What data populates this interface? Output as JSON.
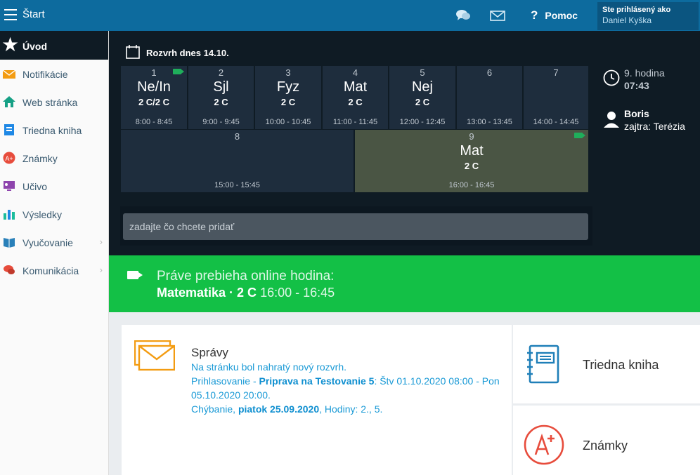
{
  "topbar": {
    "title": "Štart",
    "help_label": "Pomoc",
    "help_icon": "?",
    "user_title": "Ste prihlásený ako",
    "user_name": "Daniel Kyška"
  },
  "sidebar": {
    "active": "Úvod",
    "items": [
      {
        "label": "Notifikácie",
        "icon": "envelope-icon"
      },
      {
        "label": "Web stránka",
        "icon": "home-icon"
      },
      {
        "label": "Triedna kniha",
        "icon": "book-icon"
      },
      {
        "label": "Známky",
        "icon": "grade-icon"
      },
      {
        "label": "Učivo",
        "icon": "monitor-icon"
      },
      {
        "label": "Výsledky",
        "icon": "bar-chart-icon"
      },
      {
        "label": "Vyučovanie",
        "icon": "open-book-icon"
      },
      {
        "label": "Komunikácia",
        "icon": "chat-icon"
      }
    ]
  },
  "schedule": {
    "title": "Rozvrh dnes 14.10.",
    "row1": [
      {
        "num": "1",
        "subject": "Ne/In",
        "class": "2 C/2 C",
        "time": "8:00 - 8:45"
      },
      {
        "num": "2",
        "subject": "Sjl",
        "class": "2 C",
        "time": "9:00 - 9:45"
      },
      {
        "num": "3",
        "subject": "Fyz",
        "class": "2 C",
        "time": "10:00 - 10:45"
      },
      {
        "num": "4",
        "subject": "Mat",
        "class": "2 C",
        "time": "11:00 - 11:45"
      },
      {
        "num": "5",
        "subject": "Nej",
        "class": "2 C",
        "time": "12:00 - 12:45"
      },
      {
        "num": "6",
        "subject": "",
        "class": "",
        "time": "13:00 - 13:45"
      },
      {
        "num": "7",
        "subject": "",
        "class": "",
        "time": "14:00 - 14:45"
      }
    ],
    "row2": [
      {
        "num": "8",
        "subject": "",
        "class": "",
        "time": "15:00 - 15:45"
      },
      {
        "num": "9",
        "subject": "Mat",
        "class": "2 C",
        "time": "16:00 - 16:45"
      }
    ],
    "current_hour": "9. hodina",
    "current_time": "07:43",
    "duty_name": "Boris",
    "duty_tomorrow": "zajtra: Terézia",
    "add_placeholder": "zadajte čo chcete pridať"
  },
  "online": {
    "heading": "Práve prebieha online hodina:",
    "subject": "Matematika · 2 C",
    "time": "16:00 - 16:45"
  },
  "messages": {
    "title": "Správy",
    "line1": "Na stránku bol nahratý nový rozvrh.",
    "line2_prefix": "Prihlasovanie - ",
    "line2_bold": "Priprava na Testovanie 5",
    "line2_suffix": ": Štv 01.10.2020 08:00 - Pon 05.10.2020 20:00.",
    "line3_prefix": "Chýbanie, ",
    "line3_bold": "piatok 25.09.2020",
    "line3_suffix": ", Hodiny: 2., 5."
  },
  "tiles": {
    "triedna_kniha": "Triedna kniha",
    "znamky": "Známky"
  },
  "colors": {
    "topbar": "#0d6b9e",
    "dark_bg": "#0f1b24",
    "cell": "#1e2d3d",
    "cell_current": "#4a5544",
    "online_green": "#13c046",
    "link_blue": "#1a9ad6"
  }
}
